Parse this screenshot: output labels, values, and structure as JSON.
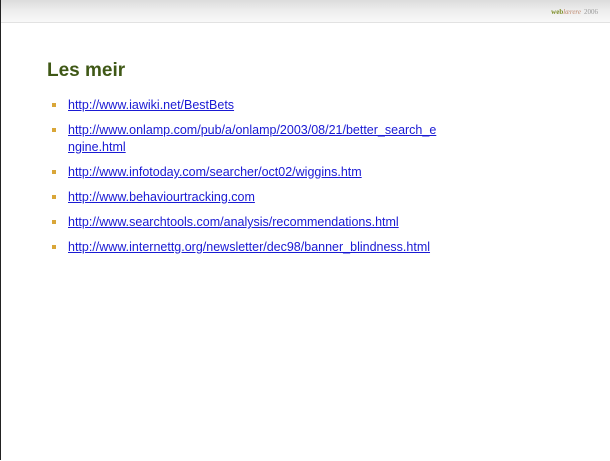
{
  "header": {
    "brand_part1": "web",
    "brand_part2": "lærere",
    "brand_year": "2006"
  },
  "slide": {
    "title": "Les meir",
    "links": [
      {
        "lines": [
          "http://www.iawiki.net/BestBets"
        ]
      },
      {
        "lines": [
          "http://www.onlamp.com/pub/a/onlamp/2003/08/21/better_search_e",
          "ngine.html"
        ]
      },
      {
        "lines": [
          "http://www.infotoday.com/searcher/oct02/wiggins.htm"
        ]
      },
      {
        "lines": [
          "http://www.behaviourtracking.com"
        ]
      },
      {
        "lines": [
          "http://www.searchtools.com/analysis/recommendations.html"
        ]
      },
      {
        "lines": [
          "http://www.internettg.org/newsletter/dec98/banner_blindness.html"
        ]
      }
    ]
  },
  "colors": {
    "title": "#3f5816",
    "link": "#1a1ad4",
    "bullet": "#d9a638"
  }
}
